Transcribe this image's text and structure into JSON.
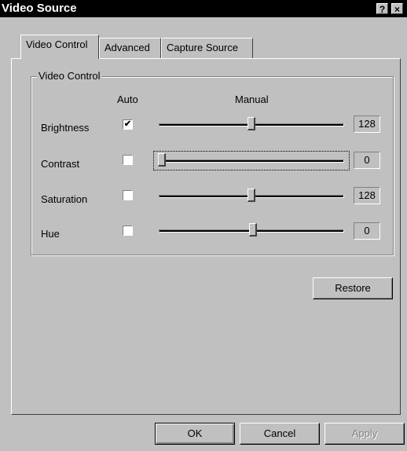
{
  "window": {
    "title": "Video Source",
    "help_label": "?",
    "close_label": "×"
  },
  "tabs": [
    {
      "label": "Video Control",
      "active": true
    },
    {
      "label": "Advanced",
      "active": false
    },
    {
      "label": "Capture Source",
      "active": false
    }
  ],
  "group": {
    "title": "Video Control",
    "auto_header": "Auto",
    "manual_header": "Manual",
    "rows": [
      {
        "label": "Brightness",
        "auto": true,
        "value": "128",
        "slider_fraction": 0.5
      },
      {
        "label": "Contrast",
        "auto": false,
        "value": "0",
        "slider_fraction": 0.0
      },
      {
        "label": "Saturation",
        "auto": false,
        "value": "128",
        "slider_fraction": 0.5
      },
      {
        "label": "Hue",
        "auto": false,
        "value": "0",
        "slider_fraction": 0.5
      }
    ],
    "checkmark": "✔"
  },
  "restore_label": "Restore",
  "footer": {
    "ok_label": "OK",
    "cancel_label": "Cancel",
    "apply_label": "Apply"
  }
}
